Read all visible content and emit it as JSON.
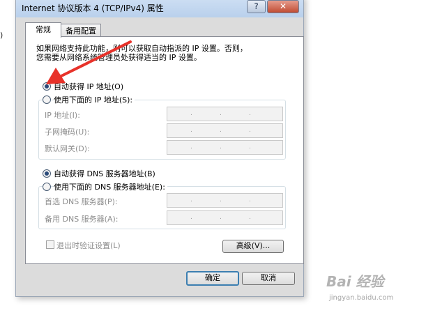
{
  "background": {
    "stray_text": ")"
  },
  "dialog": {
    "title": "Internet 协议版本 4 (TCP/IPv4) 属性",
    "help_button": "?",
    "close_button": "✕"
  },
  "tabs": [
    {
      "label": "常规",
      "selected": true
    },
    {
      "label": "备用配置",
      "selected": false
    }
  ],
  "general": {
    "description_line1": "如果网络支持此功能，则可以获取自动指派的 IP 设置。否则，",
    "description_line2": "您需要从网络系统管理员处获得适当的 IP 设置。",
    "ip_auto_label": "自动获得 IP 地址(O)",
    "ip_manual_label": "使用下面的 IP 地址(S):",
    "ip_auto_selected": true,
    "ip_fields": [
      {
        "label": "IP 地址(I):",
        "value": ". . ."
      },
      {
        "label": "子网掩码(U):",
        "value": ". . ."
      },
      {
        "label": "默认网关(D):",
        "value": ". . ."
      }
    ],
    "dns_auto_label": "自动获得 DNS 服务器地址(B)",
    "dns_manual_label": "使用下面的 DNS 服务器地址(E):",
    "dns_auto_selected": true,
    "dns_fields": [
      {
        "label": "首选 DNS 服务器(P):",
        "value": ". . ."
      },
      {
        "label": "备用 DNS 服务器(A):",
        "value": ". . ."
      }
    ],
    "validate_label": "退出时验证设置(L)",
    "validate_checked": false,
    "advanced_button": "高级(V)..."
  },
  "footer": {
    "ok_button": "确定",
    "cancel_button": "取消"
  },
  "annotation": {
    "arrow_color": "#e8322a"
  },
  "watermark": {
    "logo": "Bai 经验",
    "url": "jingyan.baidu.com"
  }
}
